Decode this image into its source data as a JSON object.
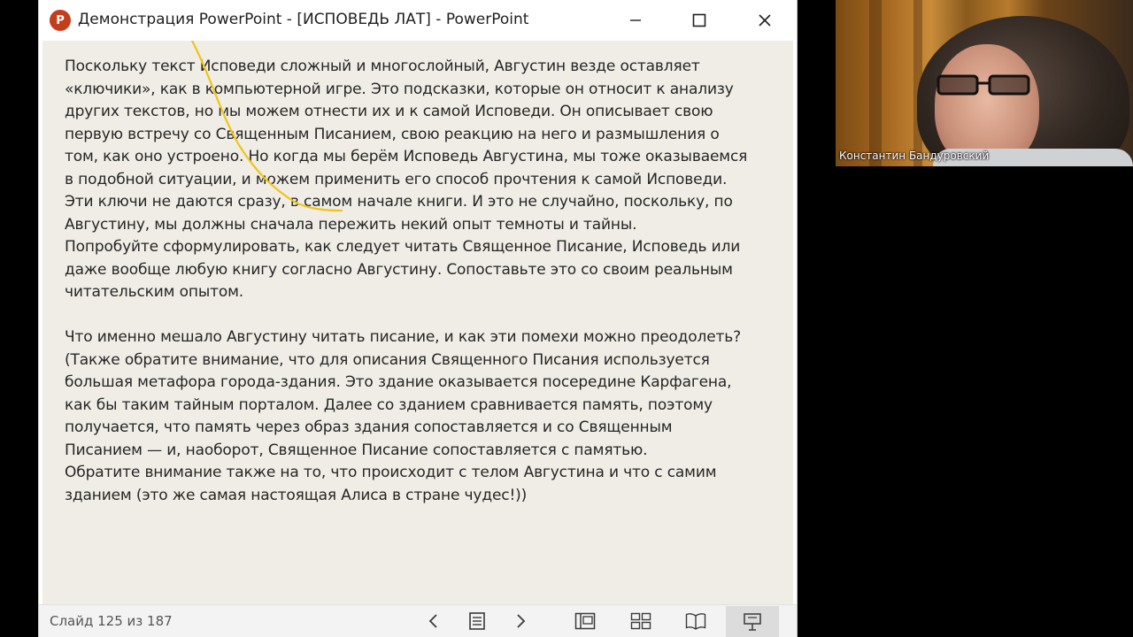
{
  "window": {
    "title": "Демонстрация PowerPoint - [ИСПОВЕДЬ ЛАТ] - PowerPoint",
    "app_icon_letter": "P"
  },
  "slide": {
    "text": "Поскольку текст Исповеди сложный и многослойный, Августин везде оставляет\n«ключики», как в компьютерной игре. Это подсказки, которые он относит к анализу\nдругих текстов, но мы можем отнести их и к самой Исповеди. Он описывает свою\nпервую встречу со Священным Писанием, свою реакцию на него и размышления о\nтом, как оно устроено. Но когда мы берём Исповедь Августина, мы тоже оказываемся\nв подобной ситуации, и можем применить его способ прочтения к самой Исповеди.\nЭти ключи не даются сразу, в самом начале книги. И это не случайно, поскольку, по\nАвгустину, мы должны сначала пережить некий опыт темноты и тайны.\nПопробуйте сформулировать, как следует читать Священное Писание, Исповедь или\nдаже вообще любую книгу согласно Августину. Сопоставьте это со своим реальным\nчитательским опытом.\n\nЧто именно мешало Августину читать писание, и как эти помехи можно преодолеть?\n(Также обратите внимание, что для описания Священного Писания используется\nбольшая метафора города-здания. Это здание оказывается посередине Карфагена,\nкак бы таким тайным порталом. Далее со зданием сравнивается память, поэтому\nполучается, что память через образ здания сопоставляется и со Священным\nПисанием — и, наоборот, Священное Писание сопоставляется с памятью.\nОбратите внимание также на то, что происходит с телом Августина и что с самим\nзданием (это же самая настоящая Алиса в стране чудес!))",
    "background_color": "#efede6",
    "pen_color": "#f0c419"
  },
  "statusbar": {
    "slide_counter": "Слайд 125 из 187"
  },
  "video": {
    "participant_name": "Константин Бандуровский"
  }
}
